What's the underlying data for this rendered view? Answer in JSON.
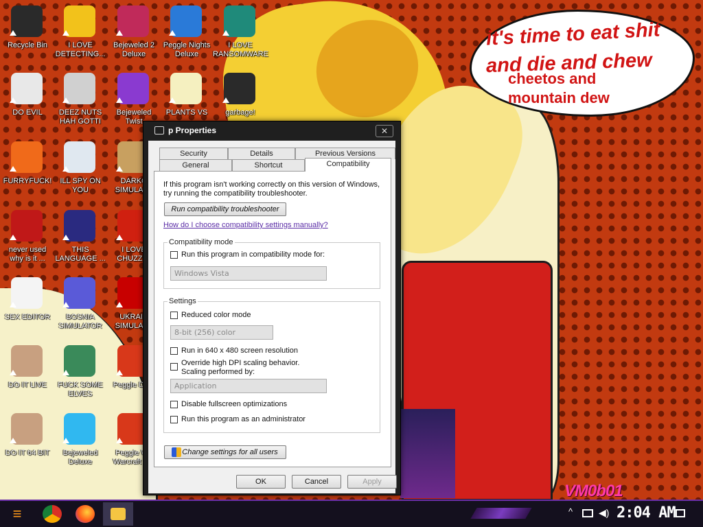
{
  "wallpaper": {
    "bubble_lines": [
      "it's time to eat shit",
      "and die and chew",
      "cheetos and",
      "mountain dew"
    ],
    "tag": "VM0b01"
  },
  "desktop_icons": [
    {
      "label": "Recycle Bin",
      "color": "#2a2a2a"
    },
    {
      "label": "I LOVE\nDETECTING...",
      "color": "#f2c21b"
    },
    {
      "label": "Bejeweled 2\nDeluxe",
      "color": "#c02a5a"
    },
    {
      "label": "Peggle Nights\nDeluxe",
      "color": "#2a7ad8"
    },
    {
      "label": "I LOVE\nRANSOMWARE",
      "color": "#1f8a7a"
    },
    {
      "label": "DO EVIL",
      "color": "#e8e8e8"
    },
    {
      "label": "DEEZ NUTS\nHAH GOTTI",
      "color": "#d0d0d0"
    },
    {
      "label": "Bejeweled\nTwist",
      "color": "#8a3ad0"
    },
    {
      "label": "PLANTS VS",
      "color": "#f5f0c0"
    },
    {
      "label": "garbage!",
      "color": "#2a2a2a"
    },
    {
      "label": "FURRYFUCK!",
      "color": "#f06a1a"
    },
    {
      "label": "ILL SPY ON\nYOU",
      "color": "#e0e8f0"
    },
    {
      "label": "DARKO\nSIMULAT...",
      "color": "#c8a060"
    },
    {
      "label": "never used\nwhy is it ...",
      "color": "#c01818"
    },
    {
      "label": "THIS\nLANGUAGE ...",
      "color": "#2a2a80"
    },
    {
      "label": "I LOVE\nCHUZZI...",
      "color": "#d02010"
    },
    {
      "label": "SEX EDITOR",
      "color": "#f4f4f4"
    },
    {
      "label": "BOSNIA\nSIMULATOR",
      "color": "#5a5ad8"
    },
    {
      "label": "UKRAIN\nSIMULAT...",
      "color": "#c80000"
    },
    {
      "label": "DO IT LIVE",
      "color": "#c8a080"
    },
    {
      "label": "FUCK SOME\nELVES",
      "color": "#3a8a5a"
    },
    {
      "label": "Peggle De...",
      "color": "#d8381a"
    },
    {
      "label": "DO IT 64 BIT",
      "color": "#c8a080"
    },
    {
      "label": "Bejeweled\nDeluxe",
      "color": "#30b8f0"
    },
    {
      "label": "Peggle Wo\nWarcraft E...",
      "color": "#d8381a"
    }
  ],
  "dialog": {
    "title": "p Properties",
    "close": "✕",
    "tabs": {
      "top": [
        "Security",
        "Details",
        "Previous Versions"
      ],
      "bottom": [
        "General",
        "Shortcut",
        "Compatibility"
      ],
      "active": "Compatibility"
    },
    "intro": "If this program isn't working correctly on this version of Windows, try running the compatibility troubleshooter.",
    "troubleshoot_button": "Run compatibility troubleshooter",
    "manual_link": "How do I choose compatibility settings manually?",
    "compat_mode": {
      "group_title": "Compatibility mode",
      "checkbox": "Run this program in compatibility mode for:",
      "checked": false,
      "dropdown_value": "Windows Vista"
    },
    "settings": {
      "group_title": "Settings",
      "reduced_color": "Reduced color mode",
      "color_dropdown": "8-bit (256) color",
      "res_640": "Run in 640 x 480 screen resolution",
      "dpi_override_1": "Override high DPI scaling behavior.",
      "dpi_override_2": "Scaling performed by:",
      "dpi_dropdown": "Application",
      "disable_fullscreen": "Disable fullscreen optimizations",
      "run_admin": "Run this program as an administrator"
    },
    "change_all_button": "Change settings for all users",
    "ok": "OK",
    "cancel": "Cancel",
    "apply": "Apply"
  },
  "taskbar": {
    "start_icon": "start-logo",
    "apps": [
      "chrome",
      "firefox",
      "file-explorer"
    ],
    "clock": "2:04 AM",
    "tray": {
      "overflow": "^"
    }
  }
}
